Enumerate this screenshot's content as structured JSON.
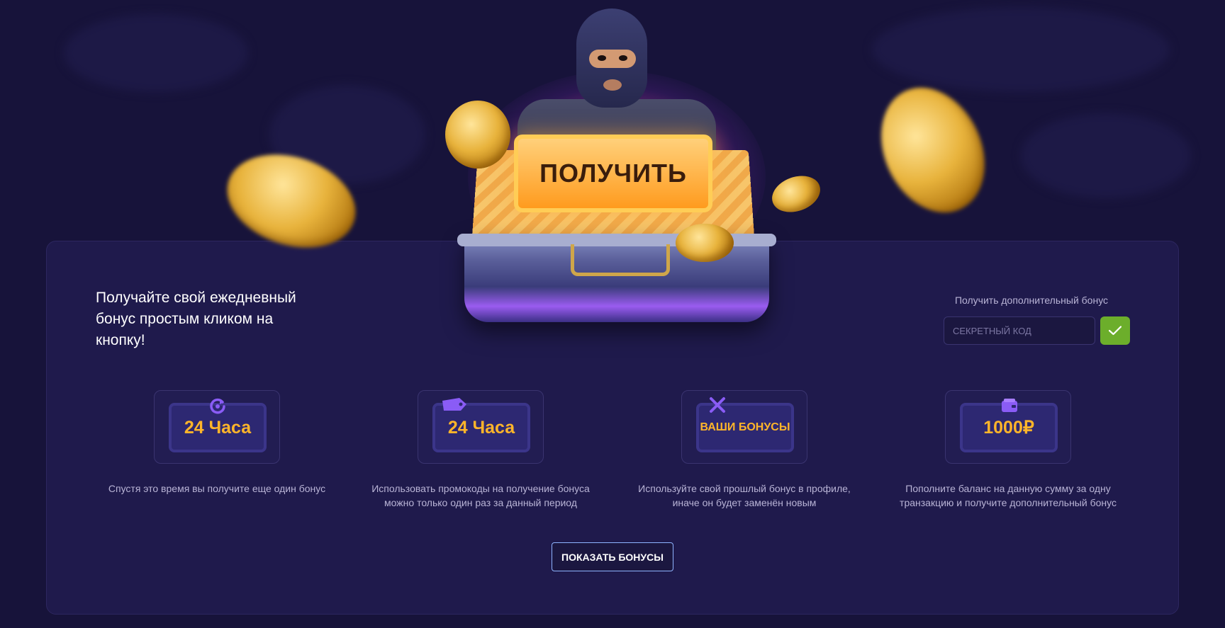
{
  "hero": {
    "claim_button_label": "ПОЛУЧИТЬ"
  },
  "intro": {
    "text": "Получайте свой ежедневный бонус простым кликом на кнопку!"
  },
  "promo": {
    "label": "Получить дополнительный бонус",
    "placeholder": "СЕКРЕТНЫЙ КОД",
    "submit_icon": "check-icon"
  },
  "cards": [
    {
      "ticket_text": "24 Часа",
      "icon": "refresh-icon",
      "description": "Спустя это время вы получите еще один бонус"
    },
    {
      "ticket_text": "24 Часа",
      "icon": "tag-icon",
      "description": "Использовать промокоды на получение бонуса можно только один раз за данный период"
    },
    {
      "ticket_text": "ВАШИ БОНУСЫ",
      "icon": "cross-icon",
      "description": "Используйте свой прошлый бонус в профиле, иначе он будет заменён новым"
    },
    {
      "ticket_text": "1000₽",
      "icon": "wallet-icon",
      "description": "Пополните баланс на данную сумму за одну транзакцию и получите дополнительный бонус"
    }
  ],
  "show_bonuses_label": "ПОКАЗАТЬ БОНУСЫ",
  "colors": {
    "background": "#17133a",
    "panel": "#1f1a4c",
    "accent_orange": "#ffb52a",
    "confirm_green": "#6cae2b",
    "icon_purple": "#8a5cf6"
  }
}
